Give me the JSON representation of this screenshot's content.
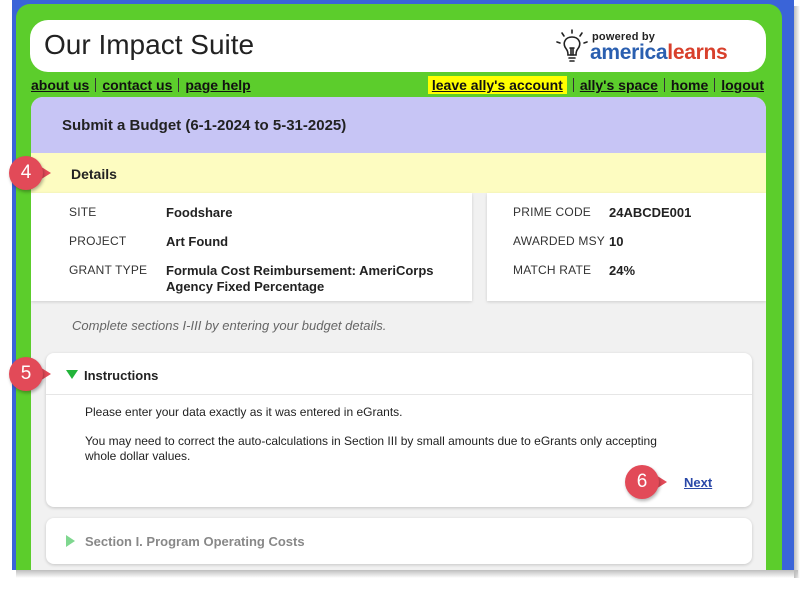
{
  "app": {
    "title": "Our Impact Suite",
    "logo": {
      "powered_by": "powered by",
      "brand_a": "america",
      "brand_b": "learns"
    }
  },
  "nav": {
    "left": [
      "about us",
      "contact us",
      "page help"
    ],
    "leave_account": "leave ally's account",
    "right": [
      "ally's space",
      "home",
      "logout"
    ]
  },
  "page": {
    "title": "Submit a Budget (6-1-2024 to 5-31-2025)",
    "details_title": "Details"
  },
  "details": {
    "left": [
      {
        "label": "SITE",
        "value": "Foodshare"
      },
      {
        "label": "PROJECT",
        "value": "Art Found"
      },
      {
        "label": "GRANT TYPE",
        "value_line1": "Formula Cost Reimbursement: AmeriCorps",
        "value_line2": "Agency Fixed Percentage"
      }
    ],
    "right": [
      {
        "label": "PRIME CODE",
        "value": "24ABCDE001"
      },
      {
        "label": "AWARDED MSY",
        "value": "10"
      },
      {
        "label": "MATCH RATE",
        "value": "24%"
      }
    ]
  },
  "hint": "Complete sections I-III by entering your budget details.",
  "instructions": {
    "title": "Instructions",
    "p1": "Please enter your data exactly as it was entered in eGrants.",
    "p2_line1": "You may need to correct the auto-calculations in Section III by small amounts due to eGrants only accepting",
    "p2_line2": "whole dollar values.",
    "next": "Next"
  },
  "section1": {
    "title": "Section I. Program Operating Costs"
  },
  "callouts": [
    "4",
    "5",
    "6"
  ],
  "colors": {
    "frame_blue": "#3a64d8",
    "frame_green": "#5ccd2c",
    "page_head": "#c7c5f5",
    "details_bar": "#fdfcc1",
    "callout": "#e24a58",
    "highlight": "#ffff00"
  }
}
